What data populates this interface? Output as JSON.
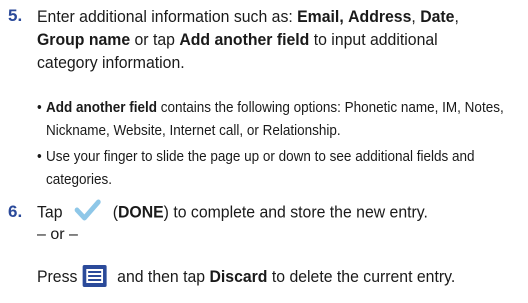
{
  "step5": {
    "number": "5.",
    "intro": "Enter additional information such as: ",
    "field_email": "Email,",
    "sep1": " ",
    "field_address": "Address",
    "sep2": ", ",
    "field_date": "Date",
    "sep3": ",",
    "field_group": "Group name",
    "mid": " or tap ",
    "add_field": "Add another field",
    "tail": " to input additional category information.",
    "bullets": [
      {
        "lead": "Add another field",
        "text": " contains the following options: Phonetic name, IM, Notes, Nickname, Website, Internet call, or Relationship."
      },
      {
        "lead": "",
        "text": "Use your finger to slide the page up or down to see additional fields and categories."
      }
    ]
  },
  "step6": {
    "number": "6.",
    "tap": "Tap",
    "done_label": "DONE",
    "done_tail": " to complete and store the new entry.",
    "or": "– or –",
    "press": "Press",
    "then_tap": " and then tap ",
    "discard": "Discard",
    "discard_tail": " to delete the current entry."
  },
  "icons": {
    "done": "checkmark-icon",
    "menu": "menu-icon"
  },
  "colors": {
    "step_number": "#2b4a9a",
    "done_check": "#8ec7e8",
    "menu_bg": "#2b4a9a"
  }
}
